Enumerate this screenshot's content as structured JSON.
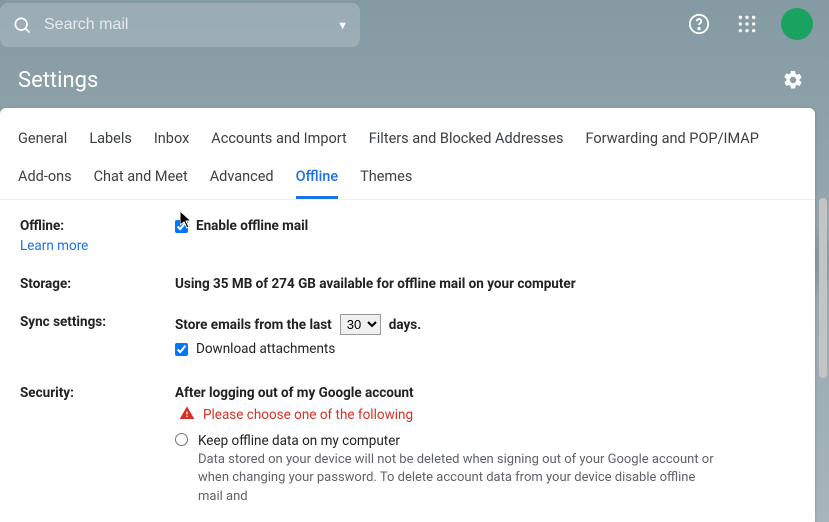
{
  "search": {
    "placeholder": "Search mail"
  },
  "page_title": "Settings",
  "tabs": {
    "general": "General",
    "labels": "Labels",
    "inbox": "Inbox",
    "accounts": "Accounts and Import",
    "filters": "Filters and Blocked Addresses",
    "forwarding": "Forwarding and POP/IMAP",
    "addons": "Add-ons",
    "chat": "Chat and Meet",
    "advanced": "Advanced",
    "offline": "Offline",
    "themes": "Themes"
  },
  "offline": {
    "label": "Offline:",
    "learn_more": "Learn more",
    "enable_label": "Enable offline mail"
  },
  "storage": {
    "label": "Storage:",
    "text": "Using 35 MB of 274 GB available for offline mail on your computer"
  },
  "sync": {
    "label": "Sync settings:",
    "prefix": "Store emails from the last",
    "days_value": "30",
    "suffix": "days.",
    "download_label": "Download attachments"
  },
  "security": {
    "label": "Security:",
    "heading": "After logging out of my Google account",
    "warning": "Please choose one of the following",
    "opt1_label": "Keep offline data on my computer",
    "opt1_desc": "Data stored on your device will not be deleted when signing out of your Google account or when changing your password. To delete account data from your device disable offline mail and"
  }
}
